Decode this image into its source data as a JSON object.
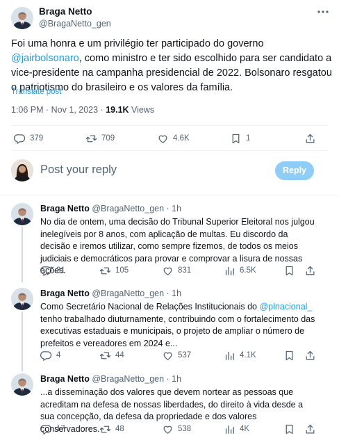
{
  "author": {
    "name": "Braga Netto",
    "handle": "@BragaNetto_gen"
  },
  "tweet": {
    "text_before": "Foi uma honra e um privilégio ter participado do governo ",
    "mention": "@jairbolsonaro",
    "text_after": ", como ministro e ter sido escolhido para ser candidato a vice-presidente na campanha presidencial de 2022. Bolsonaro resgatou o patriotismo do brasileiro e os valores da família.",
    "translate": "Translate post",
    "time": "1:06 PM · Nov 1, 2023 · ",
    "views_count": "19.1K",
    "views_label": " Views"
  },
  "stats": {
    "replies": "379",
    "reposts": "709",
    "likes": "4.6K",
    "bookmarks": "1"
  },
  "composer": {
    "placeholder": "Post your reply",
    "button": "Reply"
  },
  "replies": [
    {
      "name": "Braga Netto",
      "handle_time": "@BragaNetto_gen · 1h",
      "text": "No dia de ontem, uma decisão do Tribunal Superior Eleitoral nos julgou inelegíveis por 8 anos, com aplicação de multas. Eu discordo da decisão e iremos utilizar, como sempre fizemos, de todos os meios judiciais e democráticos para provar e comprovar a lisura de nossas ações.",
      "replies": "31",
      "reposts": "105",
      "likes": "831",
      "views": "6.5K"
    },
    {
      "name": "Braga Netto",
      "handle_time": "@BragaNetto_gen · 1h",
      "text_before": "Como Secretário Nacional de Relações Institucionais do ",
      "mention": "@plnacional_",
      "text_after": " tenho trabalhado diuturnamente, contribuindo com o fortalecimento das executivas estaduais e municipais, o projeto de ampliar o número de prefeitos e vereadores em 2024 e...",
      "replies": "4",
      "reposts": "44",
      "likes": "537",
      "views": "4.1K"
    },
    {
      "name": "Braga Netto",
      "handle_time": "@BragaNetto_gen · 1h",
      "text": "...a disseminação dos valores que devem nortear as pessoas que acreditam na defesa de nossas liberdades, do direito à vida desde a sua concepção, da defesa da propriedade e dos valores conservadores.",
      "replies": "17",
      "reposts": "48",
      "likes": "538",
      "views": "4K"
    }
  ],
  "icons": [
    "avatar",
    "more-icon",
    "reply-icon",
    "repost-icon",
    "like-icon",
    "bookmark-icon",
    "share-icon",
    "views-icon"
  ],
  "colors": {
    "accent": "#1d9bf0",
    "reply_button": "#8ecdf8",
    "text": "#0f1419",
    "muted": "#536471",
    "border": "#eff3f4",
    "thread_line": "#cfd9de"
  }
}
